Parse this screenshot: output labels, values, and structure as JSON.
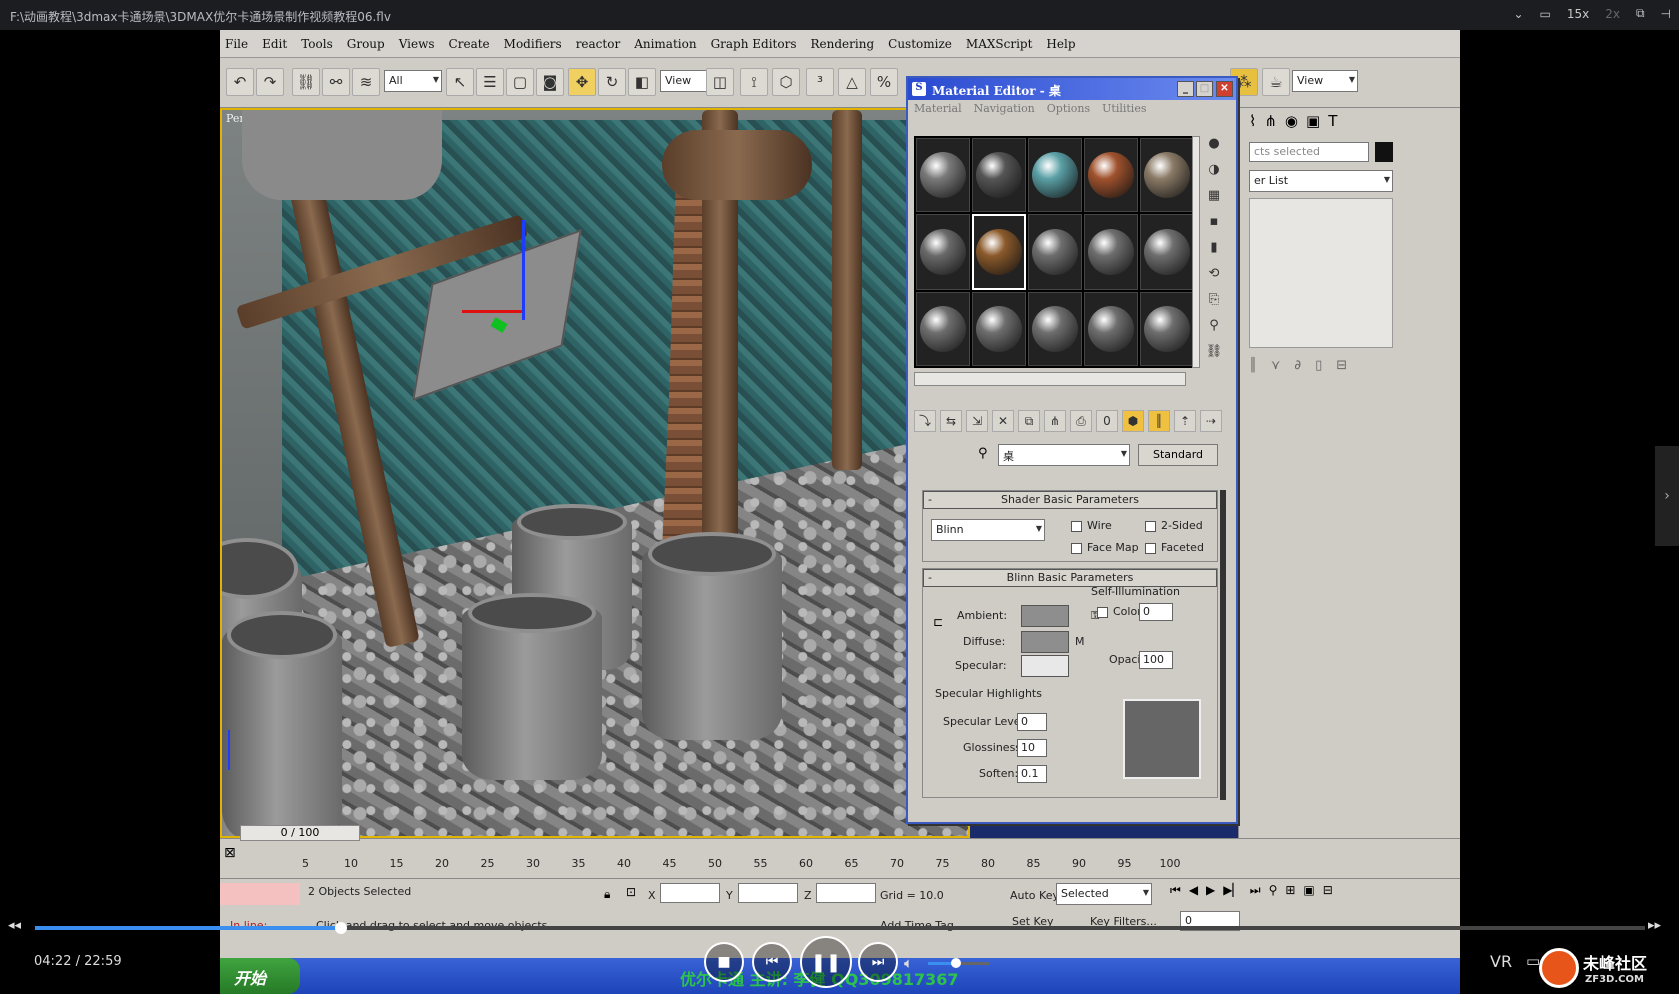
{
  "player": {
    "file_path": "F:\\动画教程\\3dmax卡通场景\\3DMAX优尔卡通场景制作视频教程06.flv",
    "speed_label": "15x",
    "speed_alt": "2x",
    "current_time": "04:22",
    "time_separator": "/",
    "total_time": "22:59",
    "progress": 0.19,
    "volume": 0.45,
    "vr_label": "VR",
    "logo_text": "未峰社区",
    "logo_sub": "ZF3D.COM"
  },
  "max": {
    "menu": [
      "File",
      "Edit",
      "Tools",
      "Group",
      "Views",
      "Create",
      "Modifiers",
      "reactor",
      "Animation",
      "Graph Editors",
      "Rendering",
      "Customize",
      "MAXScript",
      "Help"
    ],
    "toolbar": {
      "selection_filter": "All",
      "ref_coord": "View",
      "ref_coord_right": "View"
    },
    "viewport_label": "Perspective",
    "command_panel": {
      "selection_text": "cts selected",
      "modifier_list": "er List"
    },
    "timeline": {
      "frame_counter": "0 / 100",
      "ticks": [
        "5",
        "10",
        "15",
        "20",
        "25",
        "30",
        "35",
        "40",
        "45",
        "50",
        "55",
        "60",
        "65",
        "70",
        "75",
        "80",
        "85",
        "90",
        "95",
        "100"
      ]
    },
    "status": {
      "objects_selected": "2 Objects Selected",
      "prompt": "Click and drag to select and move objects",
      "x_label": "X",
      "y_label": "Y",
      "z_label": "Z",
      "grid": "Grid = 10.0",
      "auto_key": "Auto Key",
      "selected": "Selected",
      "set_key": "Set Key",
      "key_filters": "Key Filters...",
      "add_time_tag": "Add Time Tag",
      "in_line": "In line:",
      "frame_field": "0"
    },
    "taskbar": {
      "start": "开始",
      "watermark": "优尔卡通  主讲: 李健 QQ309817367"
    }
  },
  "material_editor": {
    "title": "Material Editor - 桌",
    "menu": [
      "Material",
      "Navigation",
      "Options",
      "Utilities"
    ],
    "material_name": "桌",
    "material_type": "Standard",
    "shader_rollout": "Shader Basic Parameters",
    "shader": "Blinn",
    "wire": "Wire",
    "two_sided": "2-Sided",
    "face_map": "Face Map",
    "faceted": "Faceted",
    "blinn_rollout": "Blinn Basic Parameters",
    "self_illum": "Self-Illumination",
    "color": "Color",
    "color_value": "0",
    "ambient": "Ambient:",
    "diffuse": "Diffuse:",
    "specular": "Specular:",
    "opacity": "Opacity:",
    "opacity_value": "100",
    "specular_highlights": "Specular Highlights",
    "spec_level": "Specular Level:",
    "spec_level_value": "0",
    "glossiness": "Glossiness:",
    "glossiness_value": "10",
    "soften": "Soften:",
    "soften_value": "0.1",
    "m_button": "M",
    "slot_colors": [
      "#7a7a7a",
      "#555555",
      "#5aa0a6",
      "#a0522d",
      "#8a7a66",
      "#6a6a6a",
      "#8b5a2b",
      "#6e6e6e",
      "#6e6e6e",
      "#6e6e6e",
      "#6e6e6e",
      "#6e6e6e",
      "#6e6e6e",
      "#6e6e6e",
      "#6e6e6e"
    ]
  }
}
